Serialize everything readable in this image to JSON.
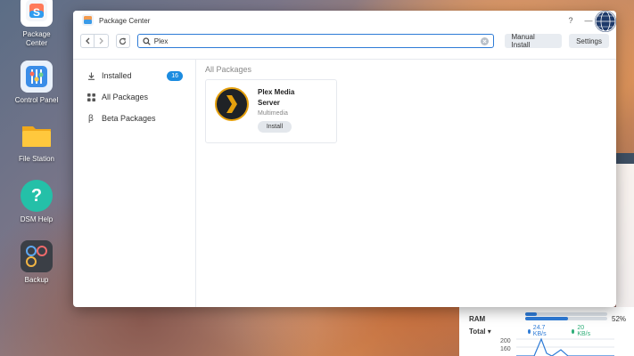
{
  "desktop": {
    "icons": [
      {
        "label": "Package\nCenter"
      },
      {
        "label": "Control Panel"
      },
      {
        "label": "File Station"
      },
      {
        "label": "DSM Help"
      },
      {
        "label": "Backup"
      }
    ],
    "package_center_line1": "Package",
    "package_center_line2": "Center"
  },
  "window": {
    "title": "Package Center",
    "help_glyph": "?",
    "minimize_glyph": "—"
  },
  "toolbar": {
    "search_value": "Plex",
    "manual_install_label": "Manual Install",
    "settings_label": "Settings"
  },
  "sidebar": {
    "items": [
      {
        "label": "Installed",
        "badge": "16",
        "icon": "download-icon"
      },
      {
        "label": "All Packages",
        "icon": "grid-icon"
      },
      {
        "label": "Beta Packages",
        "icon": "beta-icon"
      }
    ]
  },
  "main": {
    "section_title": "All Packages",
    "package": {
      "name": "Plex Media Server",
      "category": "Multimedia",
      "action_label": "Install",
      "icon": "plex-logo"
    }
  },
  "widget": {
    "ram_label": "RAM",
    "ram_percent": 52,
    "ram_percent_text": "52%",
    "total_label": "Total ▾",
    "upload": "24.7 KB/s",
    "download": "20 KB/s",
    "axis_top": "200",
    "axis_second": "160"
  },
  "colors": {
    "accent": "#2e7bd6",
    "badge": "#1c8ce0",
    "plex_orange": "#e5a00d"
  }
}
